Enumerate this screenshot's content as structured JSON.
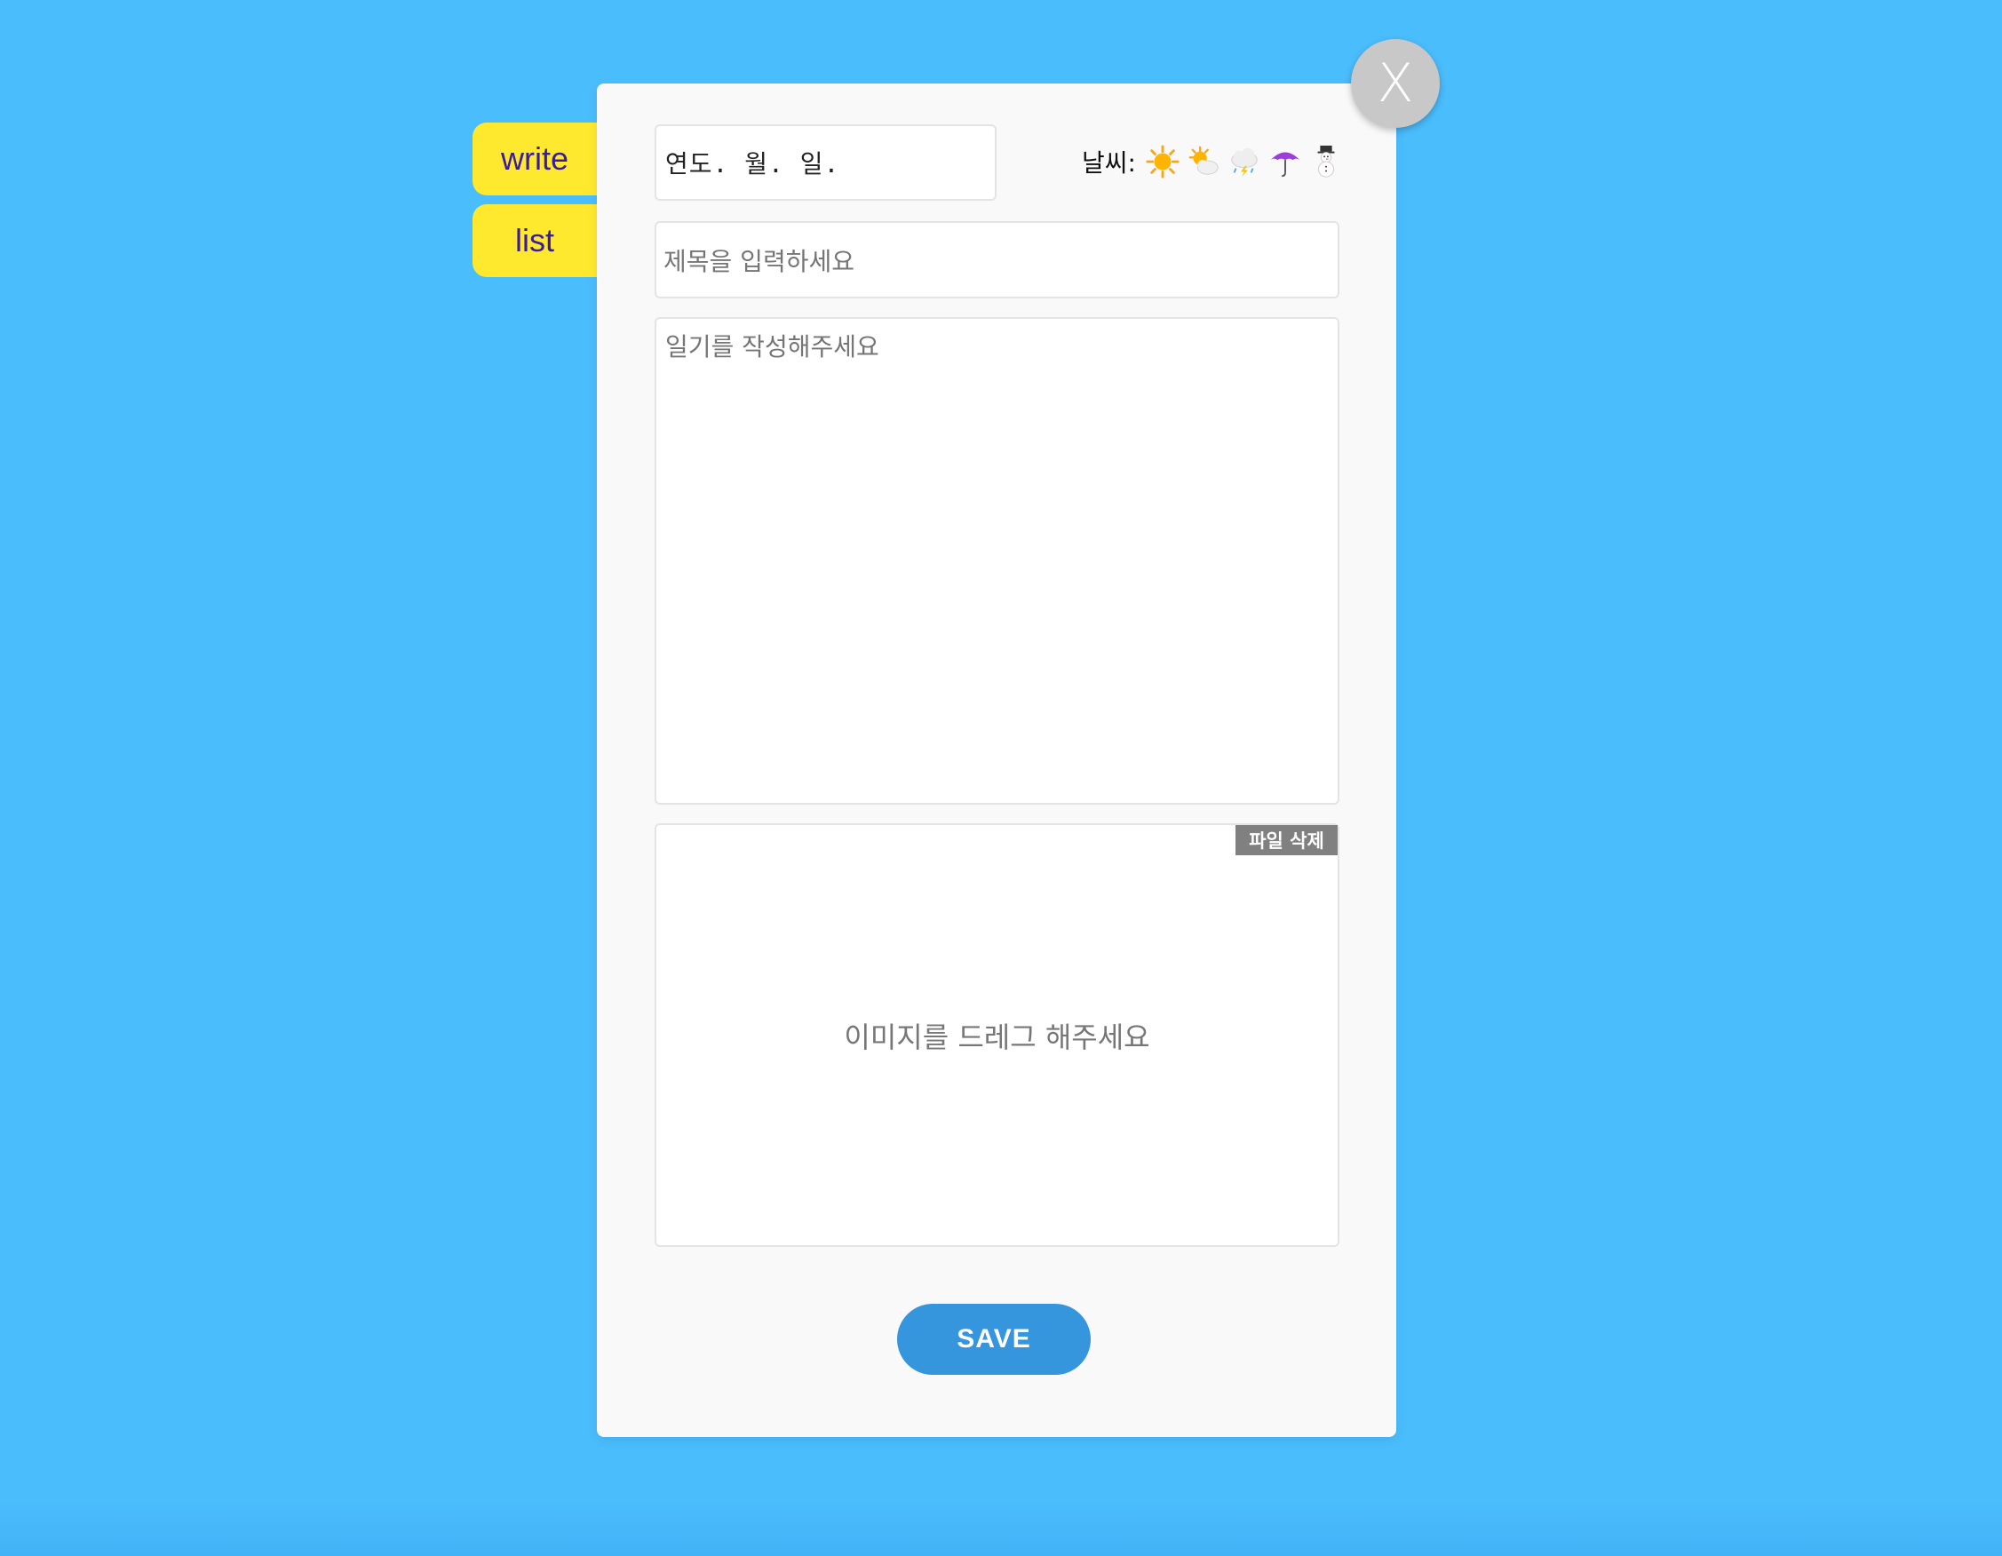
{
  "nav": {
    "write_label": "write",
    "list_label": "list"
  },
  "dialog": {
    "close_label": "X",
    "date_placeholder": "연도. 월. 일.",
    "weather_label": "날씨:",
    "weather_icons": [
      "sun-icon",
      "sun-behind-cloud-icon",
      "cloud-with-lightning-rain-icon",
      "umbrella-icon",
      "snowman-icon"
    ],
    "title_placeholder": "제목을 입력하세요",
    "body_placeholder": "일기를 작성해주세요",
    "delete_file_label": "파일 삭제",
    "image_drop_text": "이미지를 드레그 해주세요",
    "save_label": "SAVE"
  },
  "colors": {
    "background": "#4abdfd",
    "tab": "#ffe92f",
    "tab_text": "#3a1d9b",
    "save_button": "#3595dd",
    "close_button": "#c8c8c8"
  }
}
